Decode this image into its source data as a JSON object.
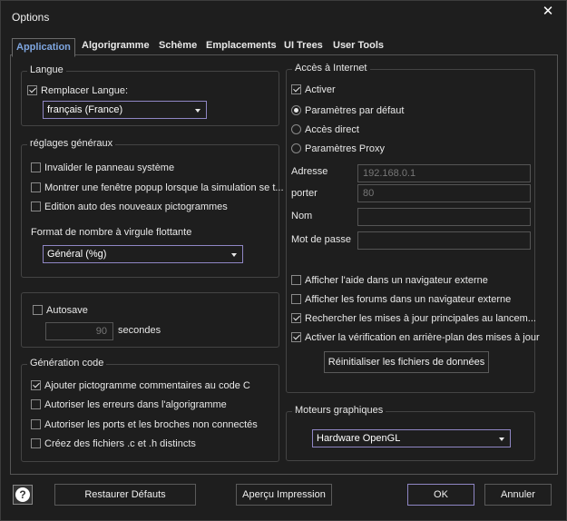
{
  "window": {
    "title": "Options",
    "close_glyph": "✕"
  },
  "tabs": [
    {
      "label": "Application"
    },
    {
      "label": "Algorigramme"
    },
    {
      "label": "Schème"
    },
    {
      "label": "Emplacements"
    },
    {
      "label": "UI Trees"
    },
    {
      "label": "User Tools"
    }
  ],
  "langue": {
    "title": "Langue",
    "replace_label": "Remplacer Langue:",
    "replace_checked": true,
    "language_value": "français (France)"
  },
  "general": {
    "title": "réglages généraux",
    "items": [
      {
        "label": "Invalider le panneau système",
        "checked": false
      },
      {
        "label": "Montrer une fenêtre popup lorsque la simulation se t...",
        "checked": false
      },
      {
        "label": "Edition auto des nouveaux pictogrammes",
        "checked": false
      }
    ],
    "float_format_label": "Format de nombre à virgule flottante",
    "float_format_value": "Général (%g)"
  },
  "autosave": {
    "label": "Autosave",
    "checked": false,
    "value": "90",
    "unit": "secondes"
  },
  "codegen": {
    "title": "Génération code",
    "items": [
      {
        "label": "Ajouter pictogramme commentaires au code C",
        "checked": true
      },
      {
        "label": "Autoriser les erreurs dans l'algorigramme",
        "checked": false
      },
      {
        "label": "Autoriser les ports et les broches non connectés",
        "checked": false
      },
      {
        "label": "Créez des fichiers .c et .h distincts",
        "checked": false
      }
    ]
  },
  "internet": {
    "title": "Accès à Internet",
    "activate_label": "Activer",
    "activate_checked": true,
    "radios": [
      {
        "label": "Paramètres par défaut",
        "checked": true
      },
      {
        "label": "Accès direct",
        "checked": false
      },
      {
        "label": "Paramètres Proxy",
        "checked": false
      }
    ],
    "address_label": "Adresse",
    "address_value": "192.168.0.1",
    "port_label": "porter",
    "port_value": "80",
    "name_label": "Nom",
    "name_value": "",
    "password_label": "Mot de passe",
    "password_value": "",
    "options": [
      {
        "label": "Afficher l'aide dans un navigateur externe",
        "checked": false
      },
      {
        "label": "Afficher les forums dans un navigateur externe",
        "checked": false
      },
      {
        "label": "Rechercher les mises à jour principales au lancem...",
        "checked": true
      },
      {
        "label": "Activer la vérification en arrière-plan des mises à jour",
        "checked": true
      }
    ],
    "reset_button": "Réinitialiser les fichiers de données"
  },
  "graphics": {
    "title": "Moteurs graphiques",
    "value": "Hardware OpenGL"
  },
  "footer": {
    "help_glyph": "?",
    "restore_button": "Restaurer Défauts",
    "preview_button": "Aperçu Impression",
    "ok_button": "OK",
    "cancel_button": "Annuler"
  },
  "colors": {
    "background": "#1e1e1e",
    "accent": "#8f86c4",
    "active_tab": "#7ea6e0"
  }
}
